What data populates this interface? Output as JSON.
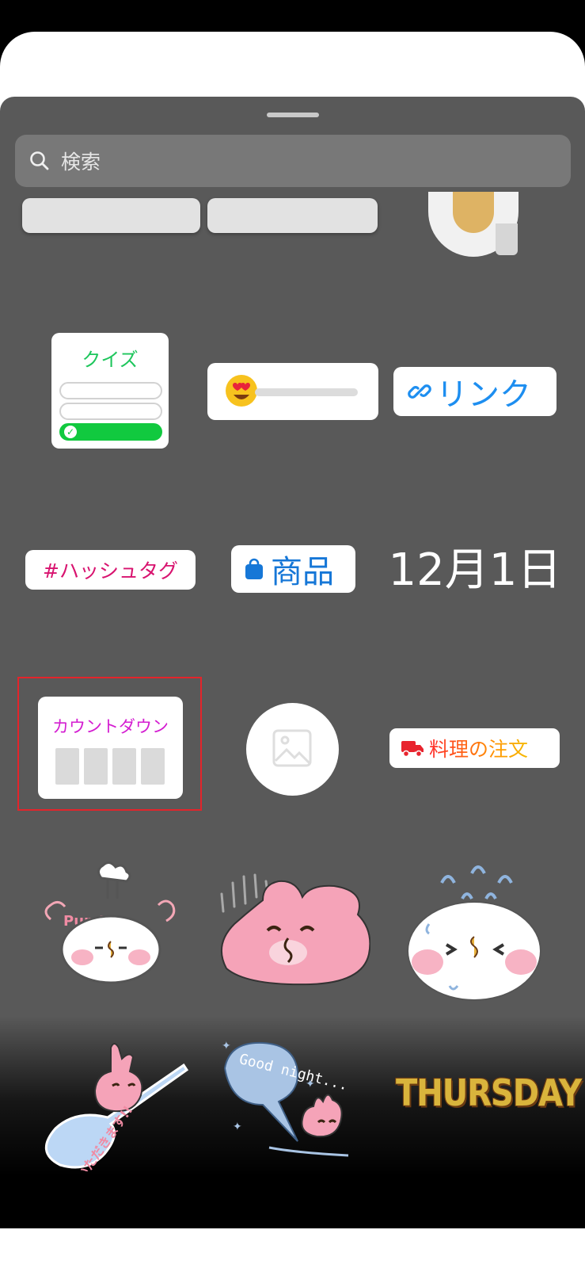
{
  "search": {
    "placeholder": "検索"
  },
  "stickers": {
    "quiz": {
      "label": "クイズ"
    },
    "link": {
      "label": "リンク"
    },
    "hashtag": {
      "label": "#ハッシュタグ"
    },
    "product": {
      "label": "商品"
    },
    "date": {
      "label": "12月1日"
    },
    "countdown": {
      "label": "カウントダウン"
    },
    "food_order": {
      "label": "料理の注文"
    },
    "pun_pun_text": "Pun Pun",
    "itadakimasu_text": "いただきます!!",
    "good_night_text": "Good night...",
    "thursday": {
      "label": "THURSDAY"
    }
  },
  "colors": {
    "sheet_bg": "#595959",
    "quiz_green": "#1ec65c",
    "link_blue": "#1d8ef0",
    "hashtag_pink": "#d8136f",
    "countdown_magenta": "#d41ed1",
    "highlight_red": "#e3242b"
  }
}
